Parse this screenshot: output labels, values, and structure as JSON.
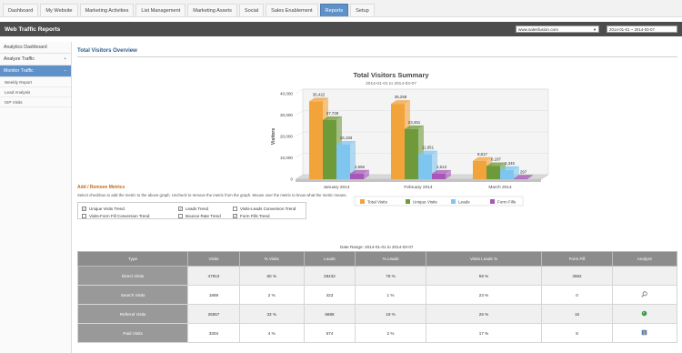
{
  "nav": {
    "tabs": [
      "Dashboard",
      "My Website",
      "Marketing Activities",
      "List Management",
      "Marketing Assets",
      "Social",
      "Sales Enablement",
      "Reports",
      "Setup"
    ],
    "active": "Reports"
  },
  "header": {
    "title": "Web Traffic Reports",
    "site": "www.salesfusion.com",
    "date_range": "2014-01-01 ~ 2014-03-07"
  },
  "sidebar": {
    "items": [
      {
        "label": "Analytics Dashboard",
        "expander": ""
      },
      {
        "label": "Analyze Traffic",
        "expander": "+"
      },
      {
        "label": "Monitor Traffic",
        "expander": "−"
      }
    ],
    "subitems": [
      "Weekly Report",
      "Lead Analysis",
      "ISP Visits"
    ]
  },
  "section": {
    "title": "Total Visitors Overview"
  },
  "chart_data": {
    "type": "bar",
    "title": "Total Visitors Summary",
    "subtitle": "2014-01-01 to 2014-03-07",
    "ylabel": "Visitors",
    "yticks": [
      "40,000",
      "30,000",
      "20,000",
      "10,000",
      "0"
    ],
    "ylim": [
      0,
      40000
    ],
    "categories": [
      "January 2014",
      "February 2014",
      "March 2014"
    ],
    "series": [
      {
        "name": "Total Visits",
        "color": "#f2a33a",
        "values": [
          36422,
          35259,
          8617
        ],
        "labels": [
          "36,422",
          "35,259",
          "8,617"
        ]
      },
      {
        "name": "Unique Visits",
        "color": "#6f9a3a",
        "values": [
          27728,
          23451,
          6187
        ],
        "labels": [
          "27,728",
          "23,451",
          "6,187"
        ]
      },
      {
        "name": "Leads",
        "color": "#7ec6ef",
        "values": [
          16193,
          11651,
          4345
        ],
        "labels": [
          "16,193",
          "11,651",
          "4,345"
        ]
      },
      {
        "name": "Form Fills",
        "color": "#a657b8",
        "values": [
          2656,
          2613,
          297
        ],
        "labels": [
          "2,656",
          "2,613",
          "297"
        ]
      }
    ],
    "legend_position": "bottom"
  },
  "metrics": {
    "title": "Add / Remove Metrics",
    "note": "Select checkbox to add the metric to the above graph. Uncheck to remove the metric from the graph. Mouse over the metric to know what the metric means.",
    "options": [
      {
        "label": "Unique Visits Trend",
        "checked": true
      },
      {
        "label": "Leads Trend",
        "checked": true
      },
      {
        "label": "Visits-Leads Conversion Trend",
        "checked": false
      },
      {
        "label": "Visits-Form Fill Conversion Trend",
        "checked": false
      },
      {
        "label": "Bounce Rate Trend",
        "checked": false
      },
      {
        "label": "Form Fills Trend",
        "checked": true
      }
    ]
  },
  "table": {
    "date_range_label": "Date Range: 2014-01-01 to 2014-03-07",
    "headers": [
      "Type",
      "Visits",
      "% Visits",
      "Leads",
      "% Leads",
      "Visits Leads %",
      "Form Fill",
      "Analyze"
    ],
    "rows": [
      {
        "type": "Direct Visits",
        "visits": "47913",
        "pct_visits": "60 %",
        "leads": "28432",
        "pct_leads": "78 %",
        "visits_leads": "59 %",
        "form_fill": "3662",
        "analyze": ""
      },
      {
        "type": "Search Visits",
        "visits": "1869",
        "pct_visits": "2 %",
        "leads": "423",
        "pct_leads": "1 %",
        "visits_leads": "23 %",
        "form_fill": "0",
        "analyze": "magnifier-icon"
      },
      {
        "type": "Referral Visits",
        "visits": "26557",
        "pct_visits": "33 %",
        "leads": "6888",
        "pct_leads": "19 %",
        "visits_leads": "26 %",
        "form_fill": "16",
        "analyze": "globe-icon"
      },
      {
        "type": "Paid Visits",
        "visits": "3304",
        "pct_visits": "4 %",
        "leads": "574",
        "pct_leads": "2 %",
        "visits_leads": "17 %",
        "form_fill": "8",
        "analyze": "dollar-icon"
      }
    ]
  }
}
